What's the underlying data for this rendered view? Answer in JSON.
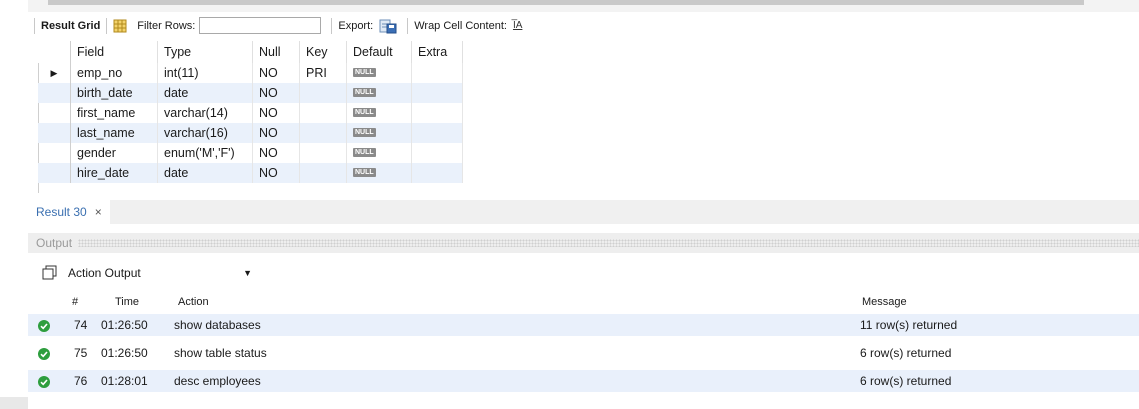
{
  "toolbar": {
    "result_grid_label": "Result Grid",
    "filter_rows_label": "Filter Rows:",
    "filter_value": "",
    "export_label": "Export:",
    "wrap_label": "Wrap Cell Content:",
    "wrap_icon_text": "I̅A"
  },
  "grid": {
    "columns": [
      "Field",
      "Type",
      "Null",
      "Key",
      "Default",
      "Extra"
    ],
    "rows": [
      {
        "field": "emp_no",
        "type": "int(11)",
        "null": "NO",
        "key": "PRI",
        "default": "NULL",
        "extra": ""
      },
      {
        "field": "birth_date",
        "type": "date",
        "null": "NO",
        "key": "",
        "default": "NULL",
        "extra": ""
      },
      {
        "field": "first_name",
        "type": "varchar(14)",
        "null": "NO",
        "key": "",
        "default": "NULL",
        "extra": ""
      },
      {
        "field": "last_name",
        "type": "varchar(16)",
        "null": "NO",
        "key": "",
        "default": "NULL",
        "extra": ""
      },
      {
        "field": "gender",
        "type": "enum('M','F')",
        "null": "NO",
        "key": "",
        "default": "NULL",
        "extra": ""
      },
      {
        "field": "hire_date",
        "type": "date",
        "null": "NO",
        "key": "",
        "default": "NULL",
        "extra": ""
      }
    ],
    "current_row_marker": "▶"
  },
  "result_tab": {
    "label": "Result 30",
    "close": "×"
  },
  "output": {
    "title": "Output",
    "selector": "Action Output",
    "columns": {
      "num": "#",
      "time": "Time",
      "action": "Action",
      "message": "Message"
    },
    "rows": [
      {
        "num": "74",
        "time": "01:26:50",
        "action": "show databases",
        "message": "11 row(s) returned"
      },
      {
        "num": "75",
        "time": "01:26:50",
        "action": "show table status",
        "message": "6 row(s) returned"
      },
      {
        "num": "76",
        "time": "01:28:01",
        "action": "desc employees",
        "message": "6 row(s) returned"
      }
    ]
  },
  "colors": {
    "ok_green": "#2e9e3e",
    "alt_row": "#eaf1fb",
    "tab_text": "#3a6fb0"
  }
}
